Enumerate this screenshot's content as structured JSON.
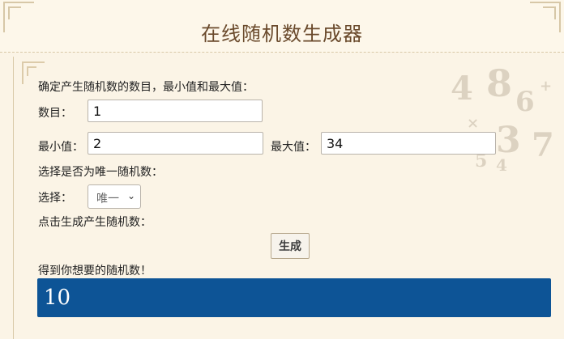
{
  "header": {
    "title": "在线随机数生成器"
  },
  "form": {
    "intro": "确定产生随机数的数目，最小值和最大值：",
    "count_label": "数目：",
    "count_value": "1",
    "min_label": "最小值：",
    "min_value": "2",
    "max_label": "最大值：",
    "max_value": "34",
    "unique_prompt": "选择是否为唯一随机数：",
    "choice_label": "选择：",
    "choice_value": "唯一",
    "generate_prompt": "点击生成产生随机数：",
    "generate_button": "生成",
    "result_label": "得到你想要的随机数！",
    "result_value": "10"
  },
  "colors": {
    "accent": "#0d5496",
    "title": "#6a4a2c",
    "background": "#fbf4e6"
  },
  "icons": {
    "dropdown": "chevron-down-icon"
  }
}
